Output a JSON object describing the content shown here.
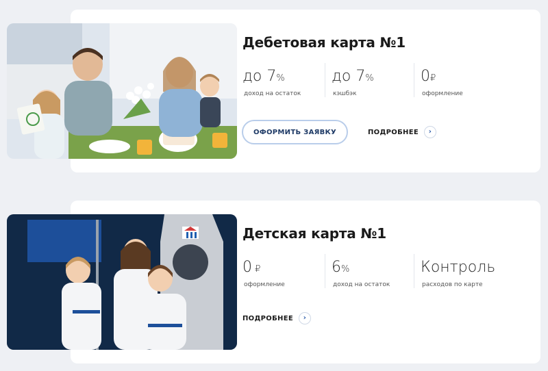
{
  "cards": [
    {
      "title": "Дебетовая карта №1",
      "stats": [
        {
          "big": "до 7",
          "unit": "%",
          "caption": "доход на остаток"
        },
        {
          "big": "до 7",
          "unit": "%",
          "caption": "кэшбэк"
        },
        {
          "big": "0",
          "unit": "₽",
          "caption": "оформление"
        }
      ],
      "apply_label": "ОФОРМИТЬ ЗАЯВКУ",
      "more_label": "ПОДРОБНЕЕ"
    },
    {
      "title": "Детская карта №1",
      "stats": [
        {
          "big": "0",
          "unit": " ₽",
          "caption": "оформление"
        },
        {
          "big": "6",
          "unit": "%",
          "caption": "доход на остаток"
        },
        {
          "big": "Контроль",
          "unit": "",
          "caption": "расходов по карте"
        }
      ],
      "more_label": "ПОДРОБНЕЕ"
    }
  ],
  "icons": {
    "more": "chevron-right-icon"
  },
  "colors": {
    "accent": "#2a5aa8",
    "button_border": "#b9cdea",
    "background": "#eef0f4"
  }
}
